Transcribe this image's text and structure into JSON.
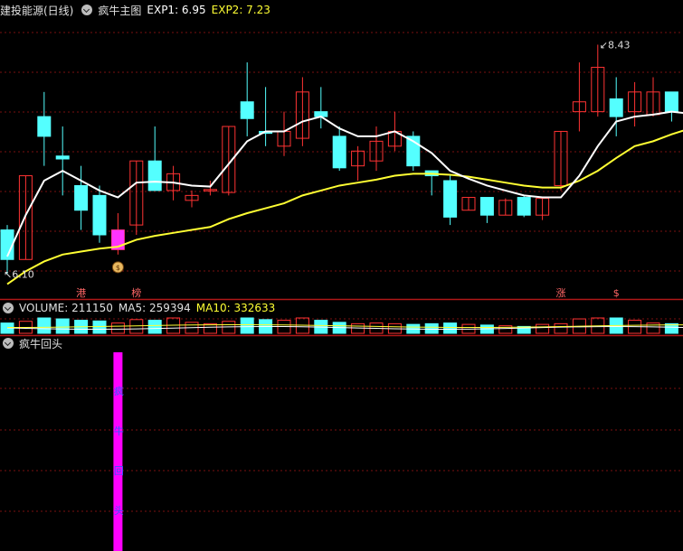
{
  "header_main": {
    "stock_name": "建投能源(日线)",
    "indicator_name": "疯牛主图",
    "exp1_label": "EXP1: 6.95",
    "exp2_label": "EXP2: 7.23"
  },
  "header_volume": {
    "volume_label": "VOLUME: 211150",
    "ma5_label": "MA5: 259394",
    "ma10_label": "MA10: 332633"
  },
  "header_sub": {
    "indicator_name": "疯牛回头"
  },
  "colors": {
    "up": "#ff3333",
    "down": "#54ffff",
    "exp1": "#ffffff",
    "exp2": "#ffff33",
    "grid": "#7a1010",
    "signal_bar": "#ff00ff",
    "signal_text": "#3355ff",
    "text": "#d0d0d0"
  },
  "chart_data": {
    "type": "candlestick",
    "price_range": [
      5.95,
      8.7
    ],
    "high_label": "8.43",
    "low_label": "6.10",
    "candles": [
      {
        "o": 6.55,
        "c": 6.25,
        "h": 6.6,
        "l": 6.1
      },
      {
        "o": 6.25,
        "c": 7.1,
        "h": 7.1,
        "l": 6.25
      },
      {
        "o": 7.7,
        "c": 7.5,
        "h": 7.95,
        "l": 7.2
      },
      {
        "o": 7.3,
        "c": 7.27,
        "h": 7.6,
        "l": 6.9
      },
      {
        "o": 7.0,
        "c": 6.75,
        "h": 7.2,
        "l": 6.55
      },
      {
        "o": 6.9,
        "c": 6.5,
        "h": 7.0,
        "l": 6.42
      },
      {
        "o": 6.35,
        "c": 6.55,
        "h": 6.72,
        "l": 6.3
      },
      {
        "o": 6.6,
        "c": 7.25,
        "h": 7.25,
        "l": 6.5
      },
      {
        "o": 7.25,
        "c": 6.95,
        "h": 7.6,
        "l": 6.95
      },
      {
        "o": 6.95,
        "c": 7.12,
        "h": 7.2,
        "l": 6.85
      },
      {
        "o": 6.85,
        "c": 6.9,
        "h": 6.95,
        "l": 6.78
      },
      {
        "o": 6.95,
        "c": 6.96,
        "h": 7.05,
        "l": 6.9
      },
      {
        "o": 6.93,
        "c": 7.6,
        "h": 7.6,
        "l": 6.9
      },
      {
        "o": 7.85,
        "c": 7.68,
        "h": 8.25,
        "l": 7.5
      },
      {
        "o": 7.55,
        "c": 7.53,
        "h": 8.0,
        "l": 7.4
      },
      {
        "o": 7.4,
        "c": 7.55,
        "h": 7.75,
        "l": 7.3
      },
      {
        "o": 7.48,
        "c": 7.95,
        "h": 8.1,
        "l": 7.4
      },
      {
        "o": 7.75,
        "c": 7.7,
        "h": 8.0,
        "l": 7.58
      },
      {
        "o": 7.5,
        "c": 7.18,
        "h": 7.6,
        "l": 7.15
      },
      {
        "o": 7.2,
        "c": 7.35,
        "h": 7.4,
        "l": 7.05
      },
      {
        "o": 7.25,
        "c": 7.45,
        "h": 7.6,
        "l": 7.15
      },
      {
        "o": 7.4,
        "c": 7.55,
        "h": 7.75,
        "l": 7.35
      },
      {
        "o": 7.5,
        "c": 7.2,
        "h": 7.55,
        "l": 7.15
      },
      {
        "o": 7.15,
        "c": 7.1,
        "h": 7.15,
        "l": 6.9
      },
      {
        "o": 7.05,
        "c": 6.68,
        "h": 7.1,
        "l": 6.6
      },
      {
        "o": 6.75,
        "c": 6.88,
        "h": 6.88,
        "l": 6.75
      },
      {
        "o": 6.88,
        "c": 6.7,
        "h": 6.88,
        "l": 6.62
      },
      {
        "o": 6.7,
        "c": 6.85,
        "h": 6.87,
        "l": 6.7
      },
      {
        "o": 6.88,
        "c": 6.7,
        "h": 6.9,
        "l": 6.68
      },
      {
        "o": 6.7,
        "c": 6.87,
        "h": 6.88,
        "l": 6.65
      },
      {
        "o": 7.0,
        "c": 7.55,
        "h": 7.55,
        "l": 6.95
      },
      {
        "o": 7.75,
        "c": 7.85,
        "h": 8.25,
        "l": 7.55
      },
      {
        "o": 7.75,
        "c": 8.2,
        "h": 8.43,
        "l": 7.7
      },
      {
        "o": 7.88,
        "c": 7.7,
        "h": 8.1,
        "l": 7.5
      },
      {
        "o": 7.75,
        "c": 7.95,
        "h": 8.05,
        "l": 7.6
      },
      {
        "o": 7.72,
        "c": 7.95,
        "h": 8.1,
        "l": 7.7
      },
      {
        "o": 7.95,
        "c": 7.75,
        "h": 7.95,
        "l": 7.65
      },
      {
        "o": 7.75,
        "c": 7.75,
        "h": 7.85,
        "l": 7.7
      }
    ],
    "exp1": [
      6.28,
      6.7,
      7.05,
      7.15,
      7.05,
      6.95,
      6.88,
      7.03,
      7.04,
      7.03,
      7.0,
      6.99,
      7.22,
      7.45,
      7.55,
      7.55,
      7.65,
      7.7,
      7.58,
      7.5,
      7.5,
      7.55,
      7.45,
      7.33,
      7.15,
      7.07,
      7.0,
      6.95,
      6.9,
      6.88,
      6.88,
      7.1,
      7.4,
      7.65,
      7.7,
      7.72,
      7.75,
      7.73
    ],
    "exp2": [
      6.0,
      6.13,
      6.23,
      6.3,
      6.33,
      6.36,
      6.38,
      6.45,
      6.49,
      6.52,
      6.55,
      6.58,
      6.66,
      6.72,
      6.77,
      6.82,
      6.9,
      6.95,
      7.0,
      7.03,
      7.06,
      7.1,
      7.12,
      7.12,
      7.11,
      7.09,
      7.06,
      7.03,
      7.0,
      6.98,
      6.98,
      7.05,
      7.15,
      7.28,
      7.4,
      7.45,
      7.52,
      7.58
    ],
    "volume": [
      30,
      35,
      48,
      42,
      38,
      36,
      30,
      40,
      38,
      45,
      32,
      28,
      35,
      55,
      40,
      38,
      45,
      38,
      32,
      28,
      30,
      28,
      26,
      28,
      30,
      26,
      24,
      22,
      20,
      26,
      28,
      42,
      50,
      48,
      38,
      30,
      28,
      28
    ],
    "volume_range": [
      0,
      160
    ],
    "markers": [
      {
        "index": 4,
        "text": "港"
      },
      {
        "index": 7,
        "text": "榜"
      },
      {
        "index": 30,
        "text": "涨"
      },
      {
        "index": 33,
        "text": "$"
      }
    ],
    "money_bag_index": 6,
    "signal": {
      "index": 6,
      "label_chars": [
        "疯",
        "牛",
        "回",
        "头"
      ]
    }
  }
}
